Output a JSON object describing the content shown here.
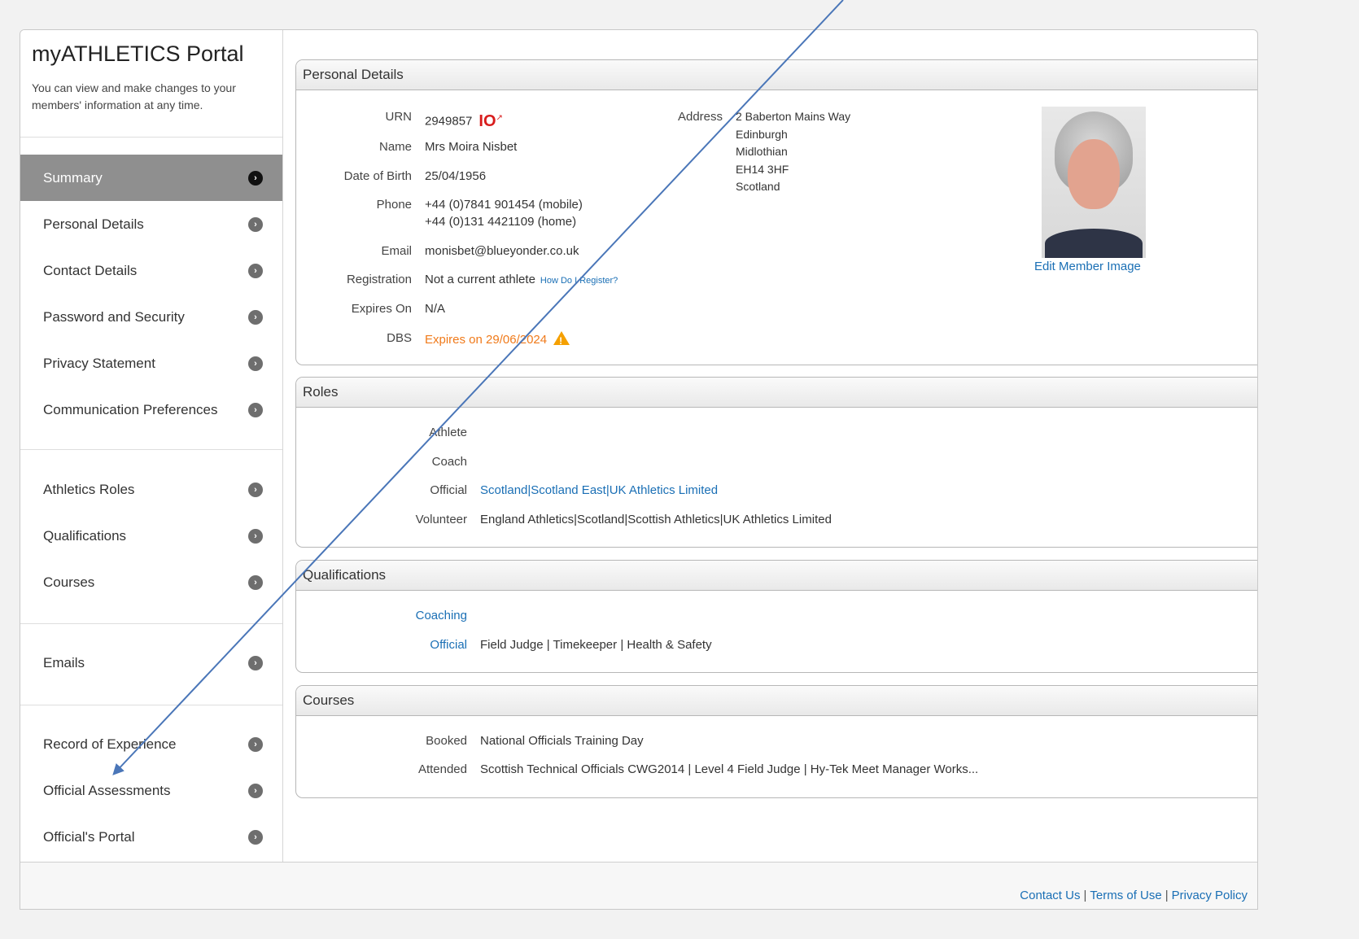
{
  "sidebar": {
    "title": "myATHLETICS Portal",
    "description": "You can view and make changes to your members' information at any time.",
    "items": [
      {
        "label": "Summary"
      },
      {
        "label": "Personal Details"
      },
      {
        "label": "Contact Details"
      },
      {
        "label": "Password and Security"
      },
      {
        "label": "Privacy Statement"
      },
      {
        "label": "Communication Preferences"
      },
      {
        "label": "Athletics Roles"
      },
      {
        "label": "Qualifications"
      },
      {
        "label": "Courses"
      },
      {
        "label": "Emails"
      },
      {
        "label": "Record of Experience"
      },
      {
        "label": "Official Assessments"
      },
      {
        "label": "Official's Portal"
      }
    ]
  },
  "personal": {
    "title": "Personal Details",
    "urn_label": "URN",
    "urn": "2949857",
    "urn_badge": "IO",
    "name_label": "Name",
    "name": "Mrs Moira Nisbet",
    "dob_label": "Date of Birth",
    "dob": "25/04/1956",
    "phone_label": "Phone",
    "phone_mobile": "+44 (0)7841 901454 (mobile)",
    "phone_home": "+44 (0)131 4421109 (home)",
    "email_label": "Email",
    "email": "monisbet@blueyonder.co.uk",
    "registration_label": "Registration",
    "registration": "Not a current athlete",
    "register_link": "How Do I Register?",
    "expires_label": "Expires On",
    "expires": "N/A",
    "dbs_label": "DBS",
    "dbs": "Expires on 29/06/2024",
    "address_label": "Address",
    "address": [
      "2 Baberton Mains Way",
      "Edinburgh",
      "Midlothian",
      "EH14 3HF",
      "Scotland"
    ],
    "edit_image": "Edit Member Image"
  },
  "roles": {
    "title": "Roles",
    "athlete_label": "Athlete",
    "coach_label": "Coach",
    "official_label": "Official",
    "official": "Scotland|Scotland East|UK Athletics Limited",
    "volunteer_label": "Volunteer",
    "volunteer": "England Athletics|Scotland|Scottish Athletics|UK Athletics Limited"
  },
  "qualifications": {
    "title": "Qualifications",
    "coaching_label": "Coaching",
    "official_label": "Official",
    "official": "Field Judge | Timekeeper | Health & Safety"
  },
  "courses": {
    "title": "Courses",
    "booked_label": "Booked",
    "booked": "National Officials Training Day",
    "attended_label": "Attended",
    "attended": "Scottish Technical Officials CWG2014 | Level 4 Field Judge | Hy-Tek Meet Manager Works..."
  },
  "footer": {
    "contact": "Contact Us",
    "terms": "Terms of Use",
    "privacy": "Privacy Policy",
    "separator": "|"
  },
  "colors": {
    "link": "#1a6fb5",
    "warning": "#f07a1a",
    "annotation_arrow": "#4a76b8",
    "active_nav": "#8f8f8f"
  }
}
